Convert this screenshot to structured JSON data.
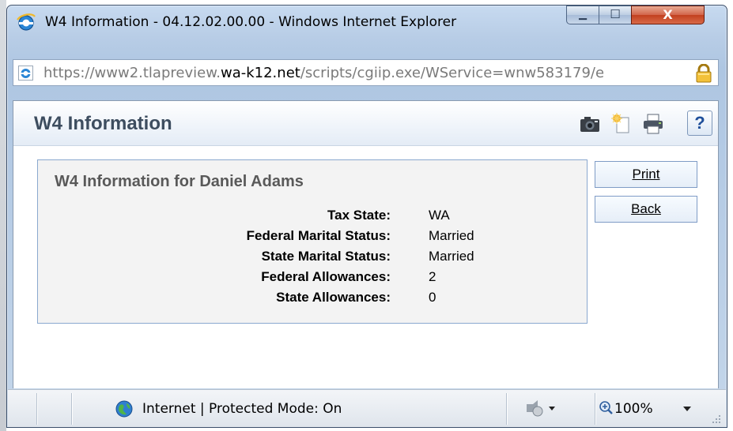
{
  "window": {
    "title": "W4 Information - 04.12.02.00.00 - Windows Internet Explorer",
    "minimize_glyph": "▁",
    "maximize_glyph": "☐",
    "close_glyph": "X"
  },
  "address": {
    "url_scheme": "https://",
    "url_pre": "www2.tlapreview.",
    "url_domain": "wa-k12.net",
    "url_path": "/scripts/cgiip.exe/WService=wnw583179/e"
  },
  "page": {
    "title": "W4 Information",
    "toolbar_icons": [
      "camera-icon",
      "new-page-icon",
      "print-icon",
      "help-icon"
    ],
    "help_label": "?"
  },
  "panel": {
    "title": "W4 Information for Daniel Adams",
    "fields": [
      {
        "label": "Tax State:",
        "value": "WA"
      },
      {
        "label": "Federal Marital Status:",
        "value": "Married"
      },
      {
        "label": "State Marital Status:",
        "value": "Married"
      },
      {
        "label": "Federal Allowances:",
        "value": "2"
      },
      {
        "label": "State Allowances:",
        "value": "0"
      }
    ]
  },
  "actions": {
    "print_label": "Print",
    "back_label": "Back"
  },
  "status": {
    "zone_text": "Internet | Protected Mode: On",
    "zoom": "100%"
  },
  "colors": {
    "window_frame": "#b8cde6",
    "close_red": "#c2401f",
    "header_text": "#3d4d5f",
    "panel_border": "#8aa8cf",
    "button_border": "#7f9cc6"
  }
}
